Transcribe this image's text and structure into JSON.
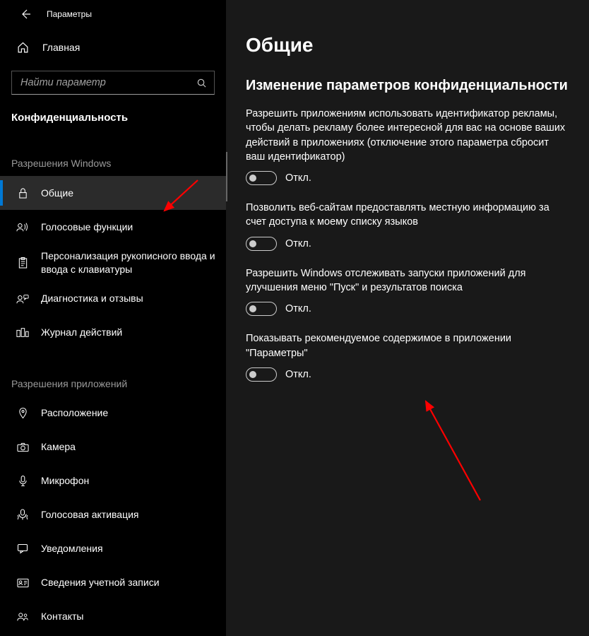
{
  "titlebar": {
    "app_title": "Параметры"
  },
  "home": {
    "label": "Главная"
  },
  "search": {
    "placeholder": "Найти параметр"
  },
  "category": {
    "title": "Конфиденциальность"
  },
  "groups": {
    "windows_perms": {
      "title": "Разрешения Windows",
      "items": [
        {
          "id": "general",
          "label": "Общие"
        },
        {
          "id": "speech",
          "label": "Голосовые функции"
        },
        {
          "id": "ink-typing",
          "label": "Персонализация рукописного ввода и ввода с клавиатуры"
        },
        {
          "id": "diagnostics",
          "label": "Диагностика и отзывы"
        },
        {
          "id": "activity-history",
          "label": "Журнал действий"
        }
      ]
    },
    "app_perms": {
      "title": "Разрешения приложений",
      "items": [
        {
          "id": "location",
          "label": "Расположение"
        },
        {
          "id": "camera",
          "label": "Камера"
        },
        {
          "id": "microphone",
          "label": "Микрофон"
        },
        {
          "id": "voice-activation",
          "label": "Голосовая активация"
        },
        {
          "id": "notifications",
          "label": "Уведомления"
        },
        {
          "id": "account-info",
          "label": "Сведения учетной записи"
        },
        {
          "id": "contacts",
          "label": "Контакты"
        }
      ]
    }
  },
  "main": {
    "heading": "Общие",
    "section_heading": "Изменение параметров конфиденциальности",
    "settings": [
      {
        "desc": "Разрешить приложениям использовать идентификатор рекламы, чтобы делать рекламу более интересной для вас на основе ваших действий в приложениях (отключение этого параметра сбросит ваш идентификатор)",
        "state": "Откл."
      },
      {
        "desc": "Позволить веб-сайтам предоставлять местную информацию за счет доступа к моему списку языков",
        "state": "Откл."
      },
      {
        "desc": "Разрешить Windows отслеживать запуски приложений для улучшения меню \"Пуск\" и результатов поиска",
        "state": "Откл."
      },
      {
        "desc": "Показывать рекомендуемое содержимое в приложении \"Параметры\"",
        "state": "Откл."
      }
    ]
  },
  "annotations": {
    "arrow_color": "#ff0000"
  }
}
